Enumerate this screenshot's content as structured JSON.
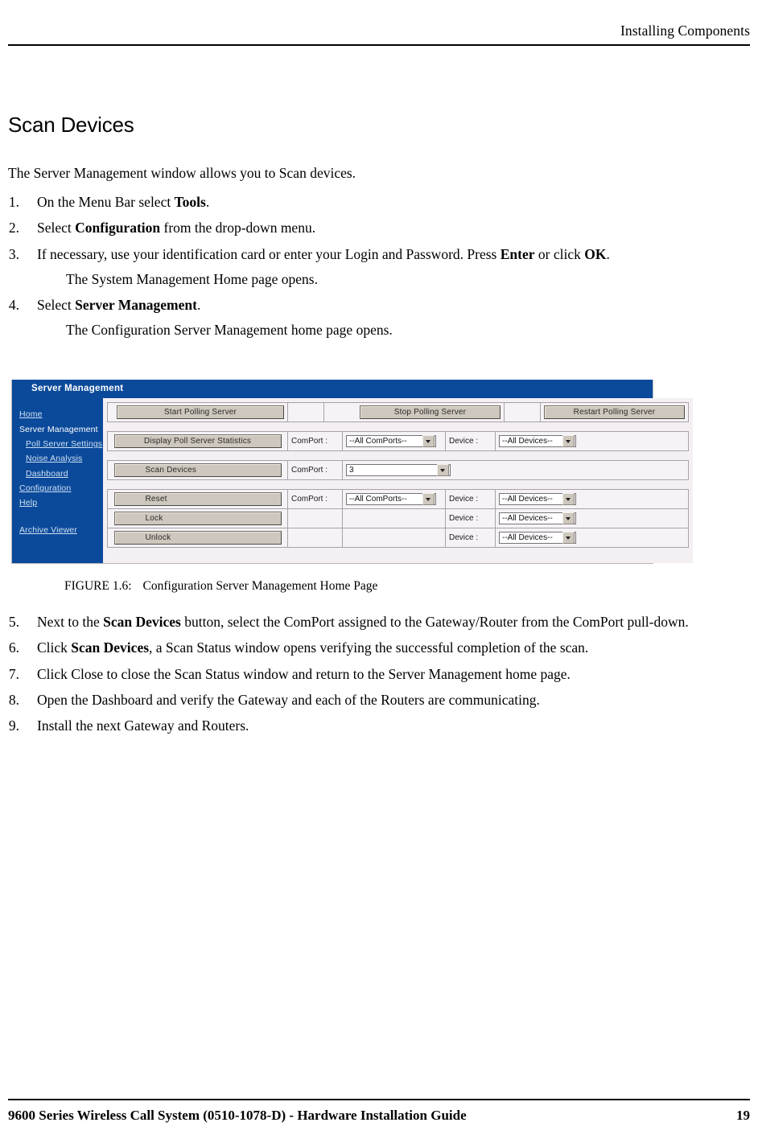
{
  "header": {
    "running_head": "Installing Components"
  },
  "page": {
    "title": "Scan Devices",
    "intro": "The Server Management window allows you to Scan devices."
  },
  "steps_upper": [
    {
      "num": "1.",
      "html": "On the Menu Bar select <span class=\"b\">Tools</span>."
    },
    {
      "num": "2.",
      "html": "Select <span class=\"b\">Configuration</span> from the drop-down menu."
    },
    {
      "num": "3.",
      "html": "If necessary, use your identification card or enter your Login and Password. Press <span class=\"b\">Enter</span> or click <span class=\"b\">OK</span>."
    },
    {
      "sub": "The System Management Home page opens."
    },
    {
      "num": "4.",
      "html": "Select <span class=\"b\">Server Management</span>."
    },
    {
      "sub": "The Configuration Server Management home page opens."
    }
  ],
  "steps_lower": [
    {
      "num": "5.",
      "html": "Next to the <span class=\"b\">Scan Devices</span> button, select the ComPort assigned to the Gateway/Router from the ComPort pull-down."
    },
    {
      "num": "6.",
      "html": "Click <span class=\"b\">Scan Devices</span>, a Scan Status window opens verifying the successful completion of the scan."
    },
    {
      "num": "7.",
      "html": "Click Close to close the Scan Status window and return to the Server Management home page."
    },
    {
      "num": "8.",
      "html": "Open the Dashboard and verify the Gateway and each of the Routers are communicating."
    },
    {
      "num": "9.",
      "html": "Install the next Gateway and Routers."
    }
  ],
  "figure": {
    "caption_label": "FIGURE 1.6:",
    "caption_text": "Configuration Server Management Home Page",
    "titlebar": "Server Management",
    "colors": {
      "chrome_blue": "#0b4a9b",
      "panel_bg": "#f3eff3",
      "button_face": "#cec7bd",
      "link_blue": "#cfe0f2"
    },
    "sidebar": [
      {
        "label": "Home",
        "indent": false,
        "current": false
      },
      {
        "label": "Server Management",
        "indent": false,
        "current": true
      },
      {
        "label": "Poll Server Settings",
        "indent": true,
        "current": false
      },
      {
        "label": "Noise Analysis",
        "indent": true,
        "current": false
      },
      {
        "label": "Dashboard",
        "indent": true,
        "current": false
      },
      {
        "label": "Configuration",
        "indent": false,
        "current": false
      },
      {
        "label": "Help",
        "indent": false,
        "current": false
      },
      {
        "label": "Archive Viewer",
        "indent": false,
        "current": false
      }
    ],
    "toolbar_row": {
      "buttons": [
        "Start Polling Server",
        "Stop Polling Server",
        "Restart Polling Server"
      ]
    },
    "rows": [
      {
        "button": "Display Poll Server Statistics",
        "comport_label": "ComPort :",
        "comport_value": "--All ComPorts--",
        "device_label": "Device :",
        "device_value": "--All Devices--"
      },
      {
        "button": "Scan Devices",
        "comport_label": "ComPort :",
        "comport_value": "3",
        "device_label": "",
        "device_value": ""
      },
      {
        "button": "Reset",
        "comport_label": "ComPort :",
        "comport_value": "--All ComPorts--",
        "device_label": "Device :",
        "device_value": "--All Devices--"
      },
      {
        "button": "Lock",
        "comport_label": "",
        "comport_value": "",
        "device_label": "Device :",
        "device_value": "--All Devices--"
      },
      {
        "button": "Unlock",
        "comport_label": "",
        "comport_value": "",
        "device_label": "Device :",
        "device_value": "--All Devices--"
      }
    ]
  },
  "footer": {
    "text": "9600 Series Wireless Call System (0510-1078-D) - Hardware Installation Guide",
    "page_number": "19"
  }
}
